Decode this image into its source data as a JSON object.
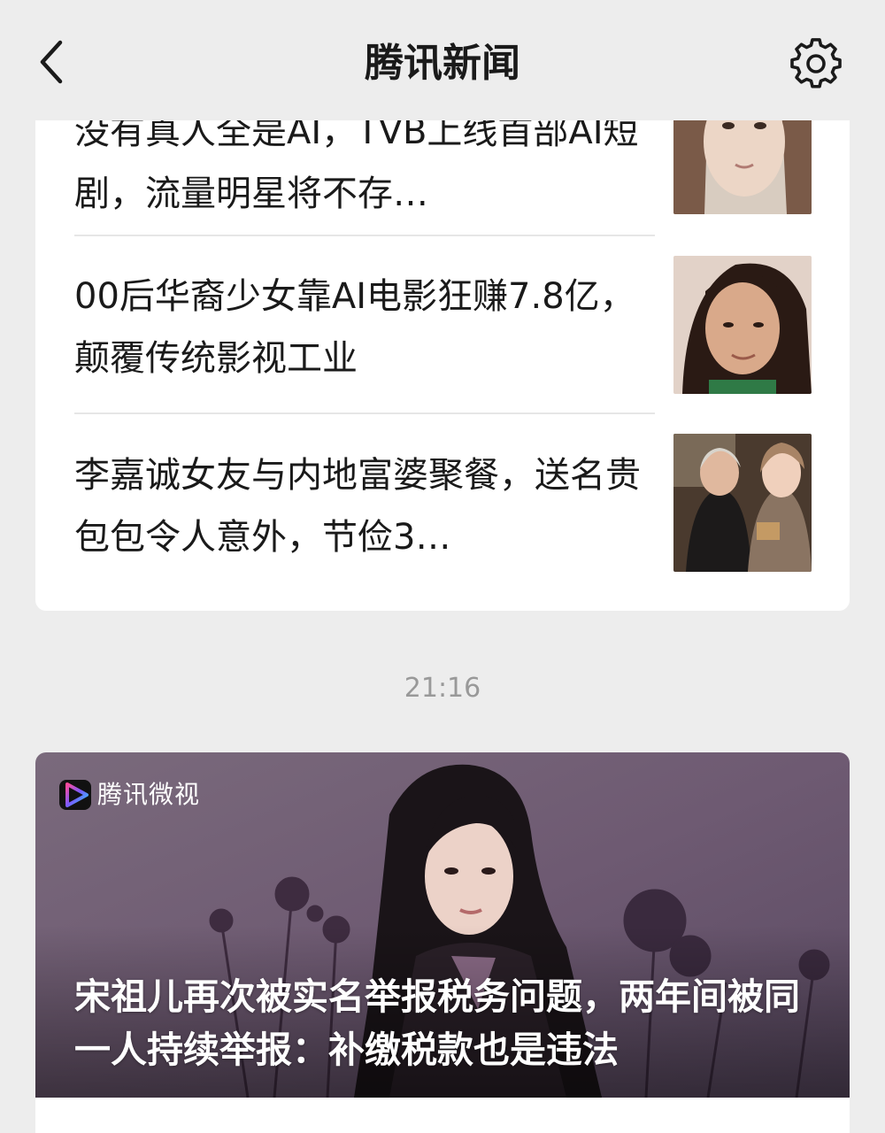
{
  "header": {
    "title": "腾讯新闻",
    "back_icon": "chevron-left-icon",
    "settings_icon": "gear-icon"
  },
  "news_list": [
    {
      "title": "没有真人全是AI，TVB上线首部AI短剧，流量明星将不存…"
    },
    {
      "title": "00后华裔少女靠AI电影狂赚7.8亿，颠覆传统影视工业"
    },
    {
      "title": "李嘉诚女友与内地富婆聚餐，送名贵包包令人意外，节俭3…"
    }
  ],
  "timestamp": "21:16",
  "feature": {
    "brand": "腾讯微视",
    "brand_icon": "play-logo-icon",
    "title": "宋祖儿再次被实名举报税务问题，两年间被同一人持续举报：补缴税款也是违法"
  },
  "colors": {
    "background": "#ededed",
    "card": "#ffffff",
    "text": "#1a1a1a",
    "timestamp": "#999999",
    "feature_bg": "#6e5a72"
  }
}
